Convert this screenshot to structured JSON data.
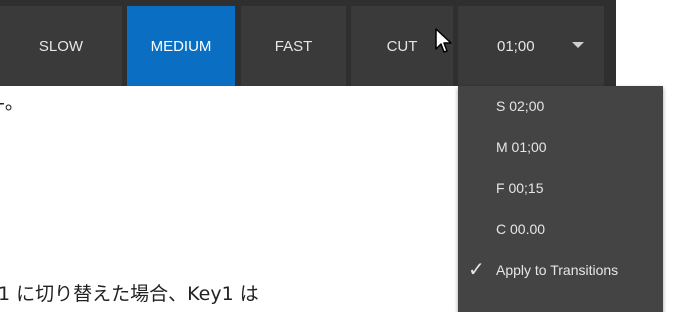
{
  "toolbar": {
    "buttons": [
      {
        "label": "SLOW"
      },
      {
        "label": "MEDIUM",
        "active": true
      },
      {
        "label": "FAST"
      },
      {
        "label": "CUT"
      }
    ],
    "time_dropdown": {
      "value": "01;00",
      "icon": "chevron-down-icon"
    }
  },
  "menu": {
    "items": [
      {
        "label": "S  02;00"
      },
      {
        "label": "M  01;00"
      },
      {
        "label": "F   00;15"
      },
      {
        "label": "C   00.00"
      },
      {
        "label": "Apply to Transitions",
        "checked": true,
        "icon": "checkmark-icon"
      }
    ]
  },
  "document": {
    "fragment_top": "-。",
    "fragment_bottom": "1 に切り替えた場合、Key1 は"
  },
  "colors": {
    "toolbar_bg": "#2f2f2f",
    "button_bg": "#3a3a3a",
    "active_button_bg": "#0a6fc2",
    "menu_bg": "#444444",
    "text_light": "#e6e6e6"
  },
  "pointer": {
    "icon": "mouse-pointer-icon"
  }
}
